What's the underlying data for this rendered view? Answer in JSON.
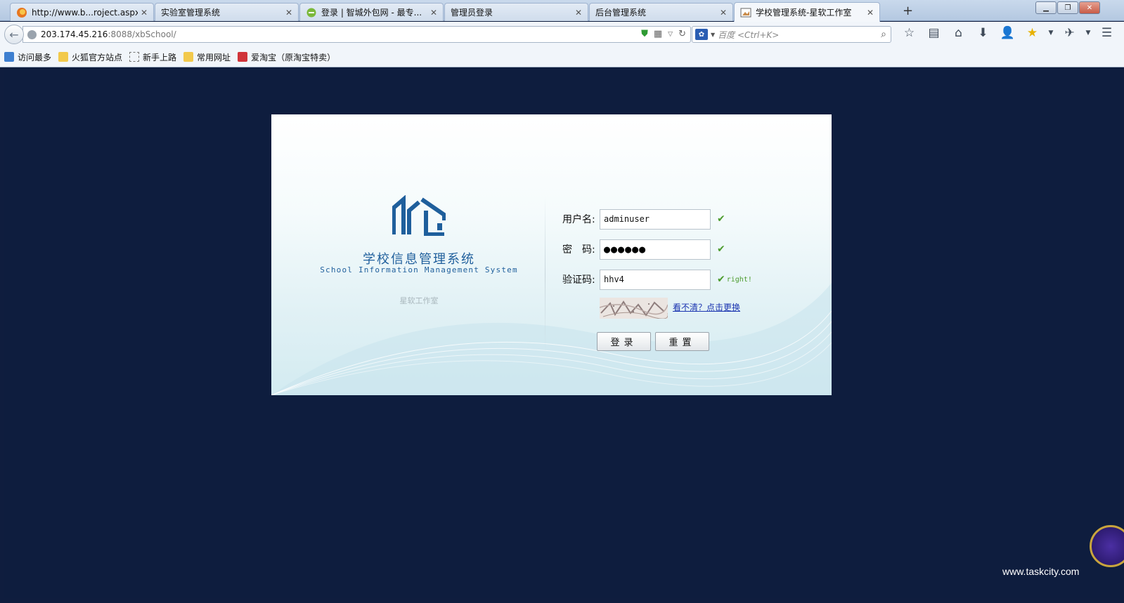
{
  "browser": {
    "tabs": [
      {
        "title": "http://www.b...roject.aspx",
        "icon": "firefox-icon",
        "active": false
      },
      {
        "title": "实验室管理系统",
        "icon": "",
        "active": false
      },
      {
        "title": "登录 | 智城外包网 - 最专...",
        "icon": "green-globe-icon",
        "active": false
      },
      {
        "title": "管理员登录",
        "icon": "",
        "active": false
      },
      {
        "title": "后台管理系统",
        "icon": "",
        "active": false
      },
      {
        "title": "学校管理系统-星软工作室",
        "icon": "page-image-icon",
        "active": true
      }
    ],
    "new_tab": "+",
    "url_host": "203.174.45.216",
    "url_path": ":8088/xbSchool/",
    "search_placeholder": "百度 <Ctrl+K>",
    "bookmarks": [
      "访问最多",
      "火狐官方站点",
      "新手上路",
      "常用网址",
      "爱淘宝（原淘宝特卖）"
    ]
  },
  "login": {
    "title_cn": "学校信息管理系统",
    "title_en": "School Information Management System",
    "studio": "星软工作室",
    "username_label": "用户名:",
    "username_value": "adminuser",
    "password_label": "密　码:",
    "password_value": "●●●●●●",
    "captcha_label": "验证码:",
    "captcha_value": "hhv4",
    "captcha_status": "right!",
    "captcha_refresh": "看不清？点击更换",
    "login_button": "登录",
    "reset_button": "重置"
  },
  "watermark": "www.taskcity.com",
  "colors": {
    "page_background": "#0e1d3e",
    "brand_blue": "#1f5f9c",
    "valid_green": "#4b9b2c",
    "link_blue": "#1a34b0"
  }
}
